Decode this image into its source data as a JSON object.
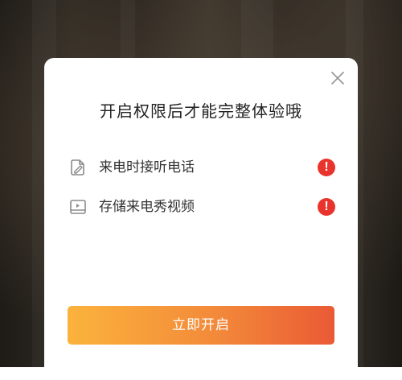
{
  "dialog": {
    "title": "开启权限后才能完整体验哦",
    "close_icon": "close-icon",
    "permissions": [
      {
        "label": "来电时接听电话",
        "icon": "phone-edit-icon",
        "status_icon": "warning-icon",
        "status_text": "!"
      },
      {
        "label": "存储来电秀视频",
        "icon": "video-storage-icon",
        "status_icon": "warning-icon",
        "status_text": "!"
      }
    ],
    "action_label": "立即开启"
  },
  "colors": {
    "warning": "#e8342c",
    "button_gradient_start": "#fbb33c",
    "button_gradient_end": "#ea5a35",
    "dim_overlay": "rgba(0,0,0,0.35)"
  }
}
